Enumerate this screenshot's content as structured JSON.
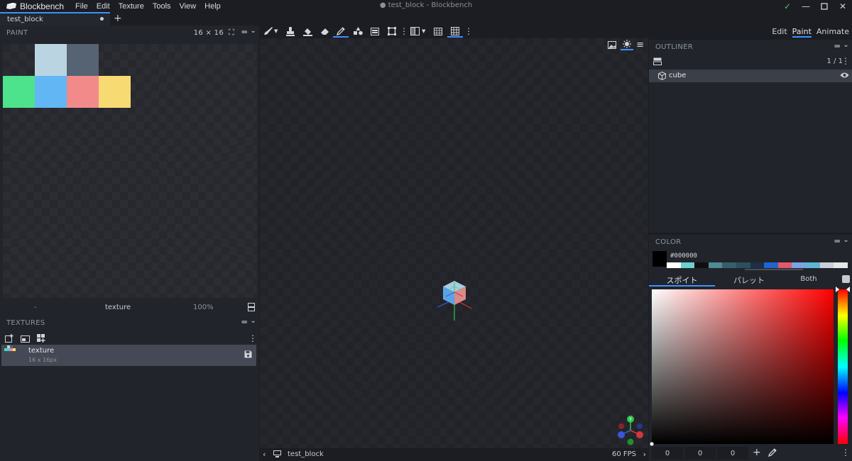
{
  "app": {
    "name": "Blockbench",
    "window_title": "● test_block - Blockbench",
    "menu": [
      "File",
      "Edit",
      "Texture",
      "Tools",
      "View",
      "Help"
    ]
  },
  "tabs": {
    "active": "test_block",
    "add": "+"
  },
  "paint": {
    "title": "PAINT",
    "size": "16 × 16",
    "footer_left": "-",
    "footer_name": "texture",
    "footer_zoom": "100%",
    "pixels": [
      {
        "col": 1,
        "row": 0,
        "color": "#bad5e1"
      },
      {
        "col": 2,
        "row": 0,
        "color": "#566372"
      },
      {
        "col": 0,
        "row": 1,
        "color": "#4de28c"
      },
      {
        "col": 1,
        "row": 1,
        "color": "#63b6f4"
      },
      {
        "col": 2,
        "row": 1,
        "color": "#f28a8a"
      },
      {
        "col": 3,
        "row": 1,
        "color": "#f8da73"
      }
    ]
  },
  "textures": {
    "title": "TEXTURES",
    "item_name": "texture",
    "item_size": "16 x 16px"
  },
  "viewport": {
    "footer_name": "test_block",
    "fps": "60 FPS"
  },
  "modes": [
    "Edit",
    "Paint",
    "Animate"
  ],
  "active_mode": "Paint",
  "outliner": {
    "title": "OUTLINER",
    "count": "1 / 1",
    "item": "cube"
  },
  "color": {
    "title": "COLOR",
    "hex": "#000000",
    "tabs": [
      "スポイト",
      "パレット",
      "Both"
    ],
    "palette": [
      "#ffffff",
      "#6ccfd2",
      "#0f0f12",
      "#4f8a95",
      "#356069",
      "#2b5059",
      "#1e2e46",
      "#2064cf",
      "#e0586a",
      "#7ea1e3",
      "#5fb6d3",
      "#c9d0d7",
      "#e4e6e8"
    ],
    "r": "0",
    "g": "0",
    "b": "0"
  }
}
